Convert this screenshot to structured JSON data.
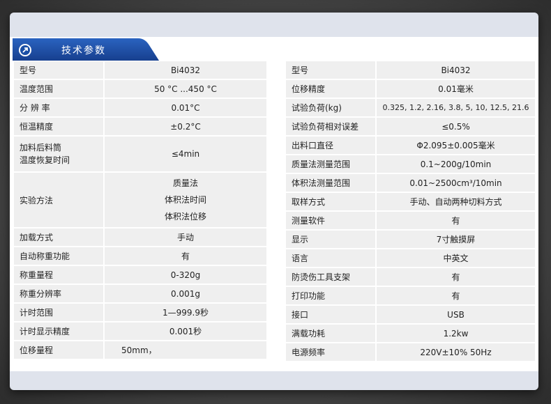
{
  "section_title": "技术参数",
  "left_table": [
    {
      "key": "型号",
      "value": "Bi4032"
    },
    {
      "key": "温度范围",
      "value": "50 °C ...450 °C"
    },
    {
      "key": "分 辨 率",
      "value": "0.01°C"
    },
    {
      "key": "恒温精度",
      "value": "±0.2°C"
    },
    {
      "key_lines": [
        "加料后料筒",
        "温度恢复时间"
      ],
      "value": "≤4min"
    },
    {
      "key": "实验方法",
      "value_lines": [
        "质量法",
        "体积法时间",
        "体积法位移"
      ]
    },
    {
      "key": "加载方式",
      "value": "手动"
    },
    {
      "key": "自动称重功能",
      "value": "有"
    },
    {
      "key": "称重量程",
      "value": "0-320g"
    },
    {
      "key": "称重分辨率",
      "value": "0.001g"
    },
    {
      "key": "计时范围",
      "value": "1—999.9秒"
    },
    {
      "key": "计时显示精度",
      "value": "0.001秒"
    },
    {
      "key": "位移量程",
      "value": "50mm，"
    }
  ],
  "right_table": [
    {
      "key": "型号",
      "value": "Bi4032"
    },
    {
      "key": "位移精度",
      "value": "0.01毫米"
    },
    {
      "key": "试验负荷(kg)",
      "value": "0.325, 1.2, 2.16, 3.8, 5, 10, 12.5, 21.6"
    },
    {
      "key": "试验负荷相对误差",
      "value": "≤0.5%"
    },
    {
      "key": "出料口直径",
      "value": "Φ2.095±0.005毫米"
    },
    {
      "key": "质量法测量范围",
      "value": "0.1~200g/10min"
    },
    {
      "key": "体积法测量范围",
      "value": "0.01~2500cm³/10min"
    },
    {
      "key": "取样方式",
      "value": "手动、自动两种切料方式"
    },
    {
      "key": "测量软件",
      "value": "有"
    },
    {
      "key": "显示",
      "value": "7寸触摸屏"
    },
    {
      "key": "语言",
      "value": "中英文"
    },
    {
      "key": "防烫伤工具支架",
      "value": "有"
    },
    {
      "key": "打印功能",
      "value": "有"
    },
    {
      "key": "接口",
      "value": "USB"
    },
    {
      "key": "满载功耗",
      "value": "1.2kw"
    },
    {
      "key": "电源频率",
      "value": "220V±10%  50Hz"
    }
  ],
  "colors": {
    "tab_blue": "#1a4fa6",
    "row_bg": "#efefef",
    "card_bg": "#dfe3ec"
  },
  "icons": [
    "arrow-circle-icon"
  ]
}
